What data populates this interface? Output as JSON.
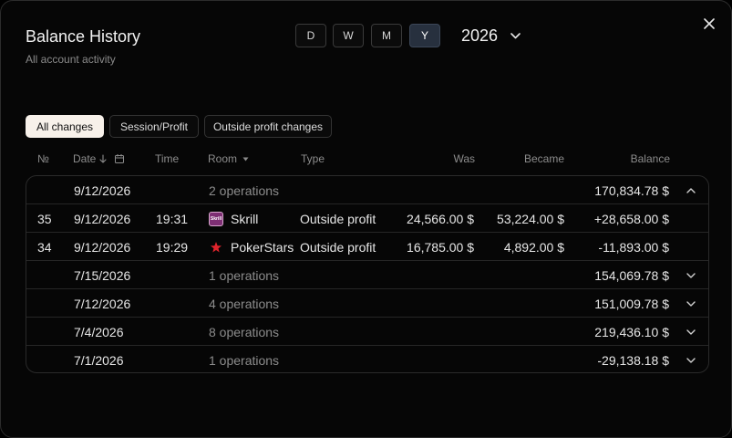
{
  "header": {
    "title": "Balance History",
    "subtitle": "All account activity",
    "periods": [
      "D",
      "W",
      "M",
      "Y"
    ],
    "active_period": "Y",
    "year": "2026"
  },
  "filters": {
    "all_changes": "All changes",
    "session_profit": "Session/Profit",
    "outside_profit": "Outside profit changes"
  },
  "columns": {
    "num": "№",
    "date": "Date",
    "time": "Time",
    "room": "Room",
    "type": "Type",
    "was": "Was",
    "became": "Became",
    "balance": "Balance"
  },
  "rows": [
    {
      "kind": "group",
      "date": "9/12/2026",
      "ops": "2 operations",
      "balance": "170,834.78 $",
      "expanded": true
    },
    {
      "kind": "detail",
      "num": "35",
      "date": "9/12/2026",
      "time": "19:31",
      "room": "Skrill",
      "room_icon": "skrill-icon",
      "type": "Outside profit",
      "was": "24,566.00 $",
      "became": "53,224.00 $",
      "balance": "+28,658.00 $"
    },
    {
      "kind": "detail",
      "num": "34",
      "date": "9/12/2026",
      "time": "19:29",
      "room": "PokerStars",
      "room_icon": "pokerstars-icon",
      "type": "Outside profit",
      "was": "16,785.00 $",
      "became": "4,892.00 $",
      "balance": "-11,893.00 $"
    },
    {
      "kind": "group",
      "date": "7/15/2026",
      "ops": "1 operations",
      "balance": "154,069.78 $",
      "expanded": false
    },
    {
      "kind": "group",
      "date": "7/12/2026",
      "ops": "4 operations",
      "balance": "151,009.78 $",
      "expanded": false
    },
    {
      "kind": "group",
      "date": "7/4/2026",
      "ops": "8 operations",
      "balance": "219,436.10 $",
      "expanded": false
    },
    {
      "kind": "group",
      "date": "7/1/2026",
      "ops": "1 operations",
      "balance": "-29,138.18 $",
      "expanded": false
    }
  ],
  "colors": {
    "active_period_bg": "#27303e",
    "active_filter_bg": "#f7f1ea",
    "skrill": "#7e2f74",
    "pokerstars": "#e0242c"
  }
}
